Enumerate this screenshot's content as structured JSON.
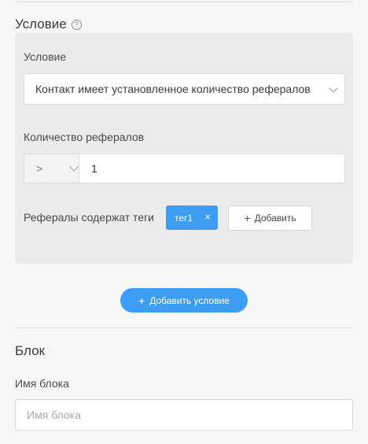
{
  "condition_section": {
    "title": "Условие",
    "help_glyph": "?",
    "panel": {
      "condition_label": "Условие",
      "condition_value": "Контакт имеет установленное количество рефералов",
      "referrals_count_label": "Количество рефералов",
      "operator_value": ">",
      "count_value": "1",
      "tags_label": "Рефералы содержат теги",
      "tags": [
        {
          "label": "тег1",
          "remove_glyph": "×"
        }
      ],
      "add_tag_label": "Добавить"
    },
    "add_condition_label": "Добавить условие"
  },
  "block_section": {
    "title": "Блок",
    "name_label": "Имя блока",
    "name_placeholder": "Имя блока",
    "name_value": ""
  },
  "colors": {
    "accent": "#3d9df2",
    "panel_bg": "#ebebeb",
    "page_bg": "#f7f7f7"
  }
}
